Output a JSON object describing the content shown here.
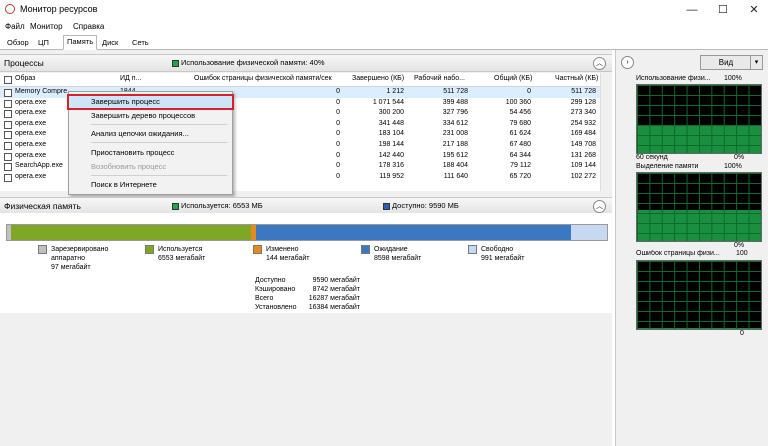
{
  "window": {
    "title": "Монитор ресурсов",
    "minimize": "—",
    "maximize": "☐",
    "close": "✕"
  },
  "menu": [
    "Файл",
    "Монитор",
    "Справка"
  ],
  "tabs": [
    "Обзор",
    "ЦП",
    "Память",
    "Диск",
    "Сеть"
  ],
  "active_tab": "Память",
  "processes": {
    "title": "Процессы",
    "usage_label": "Использование физической памяти: 40%",
    "columns": [
      "Образ",
      "ИД п...",
      "Ошибок страницы физической памяти/сек",
      "Завершено (КБ)",
      "Рабочий набо...",
      "Общий (КБ)",
      "Частный (КБ)"
    ],
    "rows": [
      [
        "Memory Compre...",
        "1844",
        "0",
        "1 212",
        "511 728",
        "0",
        "511 728"
      ],
      [
        "opera.exe",
        "",
        "0",
        "1 071 544",
        "399 488",
        "100 360",
        "299 128"
      ],
      [
        "opera.exe",
        "",
        "0",
        "300 200",
        "327 796",
        "54 456",
        "273 340"
      ],
      [
        "opera.exe",
        "",
        "0",
        "341 448",
        "334 612",
        "79 680",
        "254 932"
      ],
      [
        "opera.exe",
        "",
        "0",
        "183 104",
        "231 008",
        "61 624",
        "169 484"
      ],
      [
        "opera.exe",
        "",
        "0",
        "198 144",
        "217 188",
        "67 480",
        "149 708"
      ],
      [
        "opera.exe",
        "",
        "0",
        "142 440",
        "195 612",
        "64 344",
        "131 268"
      ],
      [
        "SearchApp.exe",
        "",
        "0",
        "178 316",
        "188 404",
        "79 112",
        "109 144"
      ],
      [
        "opera.exe",
        "",
        "0",
        "119 952",
        "111 640",
        "65 720",
        "102 272"
      ]
    ]
  },
  "context_menu": {
    "items": [
      {
        "label": "Завершить процесс",
        "highlighted": true
      },
      {
        "label": "Завершить дерево процессов"
      },
      {
        "label": "Анализ цепочки ожидания..."
      },
      {
        "label": "Приостановить процесс"
      },
      {
        "label": "Возобновить процесс",
        "disabled": true
      },
      {
        "label": "Поиск в Интернете"
      }
    ]
  },
  "physical_memory": {
    "title": "Физическая память",
    "used_label": "Используется: 6553 МБ",
    "available_label": "Доступно: 9590 МБ",
    "bar_fractions": {
      "reserved": 0.006,
      "used": 0.4,
      "modified": 0.009,
      "standby": 0.525,
      "free": 0.06
    },
    "legend": [
      {
        "key": "reserved",
        "line1": "Зарезервировано",
        "line2": "аппаратно",
        "line3": "97 мегабайт",
        "color": "#c0c0c0"
      },
      {
        "key": "used",
        "line1": "Используется",
        "line2": "6553 мегабайт",
        "line3": "",
        "color": "#7ea725"
      },
      {
        "key": "modified",
        "line1": "Изменено",
        "line2": "144 мегабайт",
        "line3": "",
        "color": "#e58a1c"
      },
      {
        "key": "standby",
        "line1": "Ожидание",
        "line2": "8598 мегабайт",
        "line3": "",
        "color": "#3a78c2"
      },
      {
        "key": "free",
        "line1": "Свободно",
        "line2": "991 мегабайт",
        "line3": "",
        "color": "#c6d9f0"
      }
    ],
    "stats": [
      {
        "label": "Доступно",
        "value": "9590 мегабайт"
      },
      {
        "label": "Кэшировано",
        "value": "8742 мегабайт"
      },
      {
        "label": "Всего",
        "value": "16287 мегабайт"
      },
      {
        "label": "Установлено",
        "value": "16384 мегабайт"
      }
    ]
  },
  "right_panel": {
    "view_label": "Вид",
    "graphs": [
      {
        "title": "Использование физи...",
        "top_pct": "100%",
        "bottom_left": "60 секунд",
        "bottom_pct": "0%",
        "fill_level": 0.4
      },
      {
        "title": "Выделение памяти",
        "top_pct": "100%",
        "bottom_left": "",
        "bottom_pct": "0%",
        "fill_level": 0.45
      },
      {
        "title": "Ошибок страницы физи...",
        "top_pct": "100",
        "bottom_left": "",
        "bottom_pct": "0",
        "fill_level": 0.02
      }
    ]
  },
  "colors": {
    "graph_green": "#1fa84a",
    "highlight_border": "#d6202b"
  }
}
